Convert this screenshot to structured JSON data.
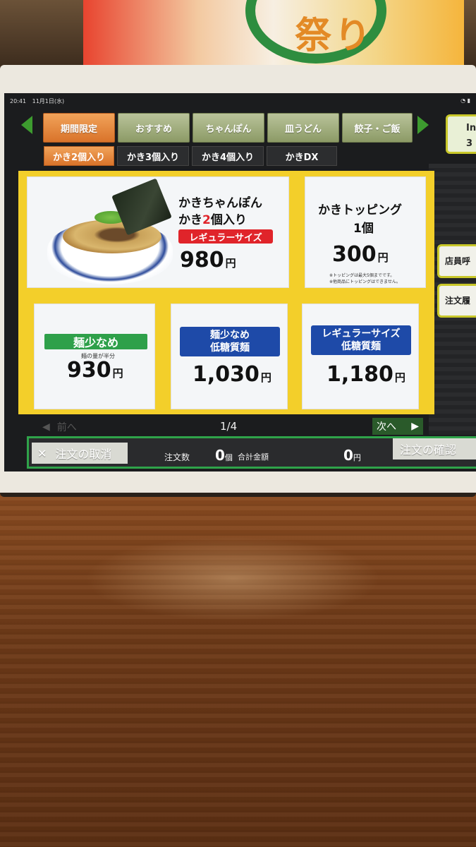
{
  "poster": {
    "text": "祭り"
  },
  "status_bar": {
    "time": "20:41",
    "date": "11月1日(水)",
    "icons": "◔ ▮"
  },
  "categories": [
    {
      "label": "期間限定",
      "active": true
    },
    {
      "label": "おすすめ"
    },
    {
      "label": "ちゃんぽん"
    },
    {
      "label": "皿うどん"
    },
    {
      "label": "餃子・ご飯"
    }
  ],
  "subcategories": [
    {
      "label": "かき2個入り",
      "active": true
    },
    {
      "label": "かき3個入り"
    },
    {
      "label": "かき4個入り"
    },
    {
      "label": "かきDX"
    }
  ],
  "info_button": {
    "label": "Inf",
    "sub": "3"
  },
  "side_buttons": {
    "call_staff": "店員呼",
    "order_history": "注文履"
  },
  "featured": {
    "name_line1": "かきちゃんぽん",
    "name_line2_pre": "かき",
    "name_line2_num": "2",
    "name_line2_post": "個入り",
    "size_badge": "レギュラーサイズ",
    "price": "980",
    "yen": "円"
  },
  "topping": {
    "name_line1": "かきトッピング",
    "name_line2": "1個",
    "price": "300",
    "yen": "円",
    "note1": "※トッピングは最大5個までです。",
    "note2": "※他商品にトッピングはできません。"
  },
  "options": [
    {
      "badge1": "麺少なめ",
      "sub": "麺の量が半分",
      "price": "930",
      "yen": "円"
    },
    {
      "badge1": "麺少なめ",
      "badge2": "低糖質麺",
      "price": "1,030",
      "yen": "円"
    },
    {
      "badge1": "レギュラーサイズ",
      "badge2": "低糖質麺",
      "price": "1,180",
      "yen": "円"
    }
  ],
  "pagination": {
    "prev": "前へ",
    "page": "1/4",
    "next": "次へ"
  },
  "bottom": {
    "cancel": "注文の取消",
    "count_label": "注文数",
    "count_value": "0",
    "count_unit": "個",
    "total_label": "合計金額",
    "total_value": "0",
    "total_unit": "円",
    "confirm": "注文の確認"
  }
}
